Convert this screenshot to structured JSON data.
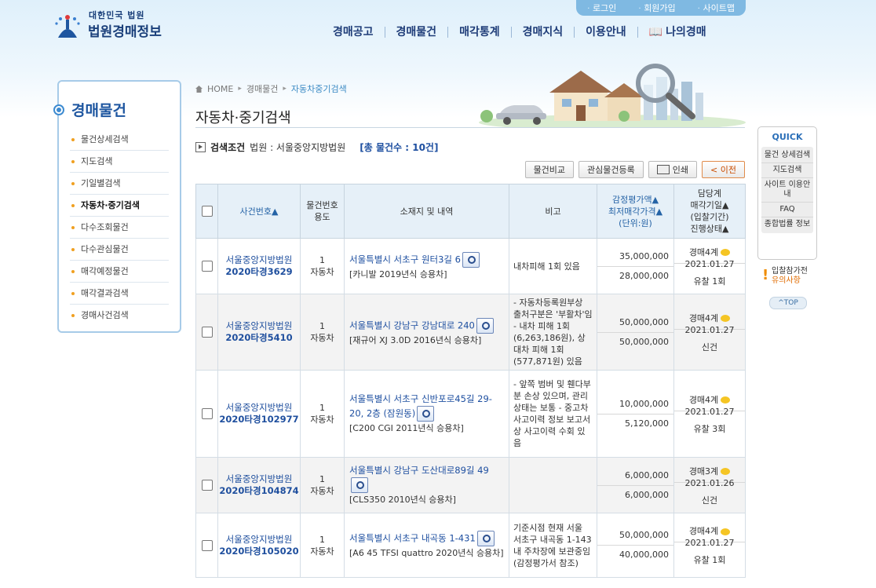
{
  "header": {
    "logo_small": "대한민국 법원",
    "logo_big": "법원경매정보",
    "util_links": [
      "로그인",
      "회원가입",
      "사이트맵"
    ],
    "gnb": [
      "경매공고",
      "경매물건",
      "매각통계",
      "경매지식",
      "이용안내",
      "나의경매"
    ]
  },
  "sidebar": {
    "title": "경매물건",
    "items": [
      {
        "label": "물건상세검색"
      },
      {
        "label": "지도검색"
      },
      {
        "label": "기일별검색"
      },
      {
        "label": "자동차·중기검색"
      },
      {
        "label": "다수조회물건"
      },
      {
        "label": "다수관심물건"
      },
      {
        "label": "매각예정물건"
      },
      {
        "label": "매각결과검색"
      },
      {
        "label": "경매사건검색"
      }
    ]
  },
  "breadcrumb": {
    "home": "HOME",
    "level1": "경매물건",
    "current": "자동차중기검색"
  },
  "page_title": "자동차·중기검색",
  "search": {
    "label": "검색조건",
    "court": "법원 : 서울중앙지방법원",
    "total": "[총 물건수 : 10건]"
  },
  "buttons": {
    "compare": "물건비교",
    "interest": "관심물건등록",
    "print": "인쇄",
    "prev": "< 이전"
  },
  "table": {
    "headers": {
      "case_no": "사건번호▲",
      "item_no_l1": "물건번호",
      "item_no_l2": "용도",
      "location": "소재지 및 내역",
      "note": "비고",
      "price_l1": "감정평가액▲",
      "price_l2": "최저매각가격▲",
      "price_l3": "(단위:원)",
      "sched_l1": "담당계",
      "sched_l2": "매각기일▲",
      "sched_l3": "(입찰기간)",
      "sched_l4": "진행상태▲"
    },
    "rows": [
      {
        "court": "서울중앙지방법원",
        "case": "2020타경3629",
        "item_no": "1",
        "use": "자동차",
        "address": "서울특별시 서초구 원터3길 6",
        "desc": "[카니발 2019년식 승용차]",
        "note": "내차피해 1회 있음",
        "appraisal": "35,000,000",
        "minimum": "28,000,000",
        "dept": "경매4계",
        "date": "2021.01.27",
        "status": "유찰 1회"
      },
      {
        "court": "서울중앙지방법원",
        "case": "2020타경5410",
        "item_no": "1",
        "use": "자동차",
        "address": "서울특별시 강남구 강남대로 240",
        "desc": "[재규어 XJ 3.0D 2016년식 승용차]",
        "note": "- 자동차등록원부상 출처구분은 '부활차'임 - 내차 피해 1회(6,263,186원), 상대차 피해 1회(577,871원) 있음",
        "appraisal": "50,000,000",
        "minimum": "50,000,000",
        "dept": "경매4계",
        "date": "2021.01.27",
        "status": "신건"
      },
      {
        "court": "서울중앙지방법원",
        "case": "2020타경102977",
        "item_no": "1",
        "use": "자동차",
        "address": "서울특별시 서초구 신반포로45길 29-20, 2층 (잠원동)",
        "desc": "[C200 CGI 2011년식 승용차]",
        "note": "- 앞쪽 범버 및 휀다부분 손상 있으며, 관리상태는 보통 - 중고차 사고이력 정보 보고서상 사고이력 수회 있음",
        "appraisal": "10,000,000",
        "minimum": "5,120,000",
        "dept": "경매4계",
        "date": "2021.01.27",
        "status": "유찰 3회"
      },
      {
        "court": "서울중앙지방법원",
        "case": "2020타경104874",
        "item_no": "1",
        "use": "자동차",
        "address": "서울특별시 강남구 도산대로89길 49",
        "desc": "[CLS350 2010년식 승용차]",
        "note": "",
        "appraisal": "6,000,000",
        "minimum": "6,000,000",
        "dept": "경매3계",
        "date": "2021.01.26",
        "status": "신건"
      },
      {
        "court": "서울중앙지방법원",
        "case": "2020타경105020",
        "item_no": "1",
        "use": "자동차",
        "address": "서울특별시 서초구 내곡동 1-431",
        "desc": "[A6 45 TFSI quattro 2020년식 승용차]",
        "note": "기준시점 현재 서울 서초구 내곡동 1-143 내 주차장에 보관중임(감정평가서 참조)",
        "appraisal": "50,000,000",
        "minimum": "40,000,000",
        "dept": "경매4계",
        "date": "2021.01.27",
        "status": "유찰 1회"
      }
    ]
  },
  "quick": {
    "title": "QUICK",
    "items": [
      "물건 상세검색",
      "지도검색",
      "사이트 이용안내",
      "FAQ",
      "종합법률 정보"
    ],
    "notice_l1": "입찰참가전",
    "notice_l2": "유의사항",
    "top": "^TOP"
  }
}
